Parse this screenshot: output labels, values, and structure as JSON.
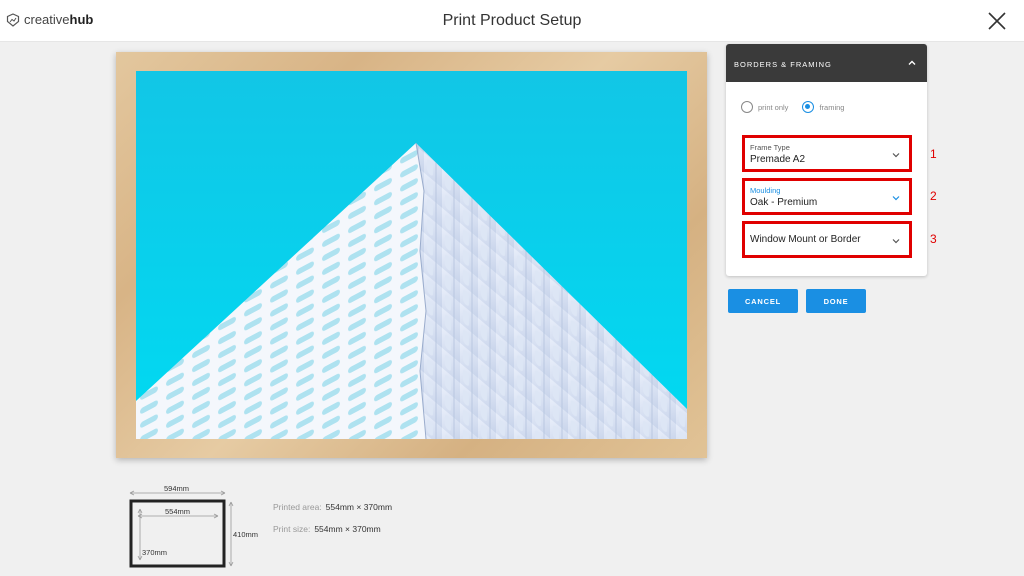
{
  "header": {
    "logo_prefix": "creative",
    "logo_bold": "hub",
    "title": "Print Product Setup"
  },
  "panel": {
    "title": "BORDERS & FRAMING",
    "options": [
      {
        "label": "print only",
        "selected": false
      },
      {
        "label": "framing",
        "selected": true
      }
    ]
  },
  "fields": [
    {
      "label": "Frame Type",
      "value": "Premade A2",
      "number": "1"
    },
    {
      "label": "Moulding",
      "value": "Oak - Premium",
      "number": "2"
    },
    {
      "label": "",
      "value": "Window Mount or Border",
      "number": "3"
    }
  ],
  "buttons": {
    "cancel": "CANCEL",
    "done": "DONE"
  },
  "dimensions": {
    "outer_width": "594mm",
    "inner_width": "554mm",
    "inner_height": "370mm",
    "outer_height": "410mm"
  },
  "info": {
    "printed_area_label": "Printed area:",
    "printed_area_value": "554mm × 370mm",
    "print_size_label": "Print size:",
    "print_size_value": "554mm × 370mm"
  },
  "colors": {
    "accent": "#1a8fe3",
    "highlight": "#e00000",
    "panel_header": "#3a3a3a",
    "sky": "#00d2ee",
    "frame_wood": "#dcbb8e"
  },
  "icons": [
    "creativehub-logo-icon",
    "close-icon",
    "chevron-up-icon",
    "chevron-down-icon"
  ]
}
